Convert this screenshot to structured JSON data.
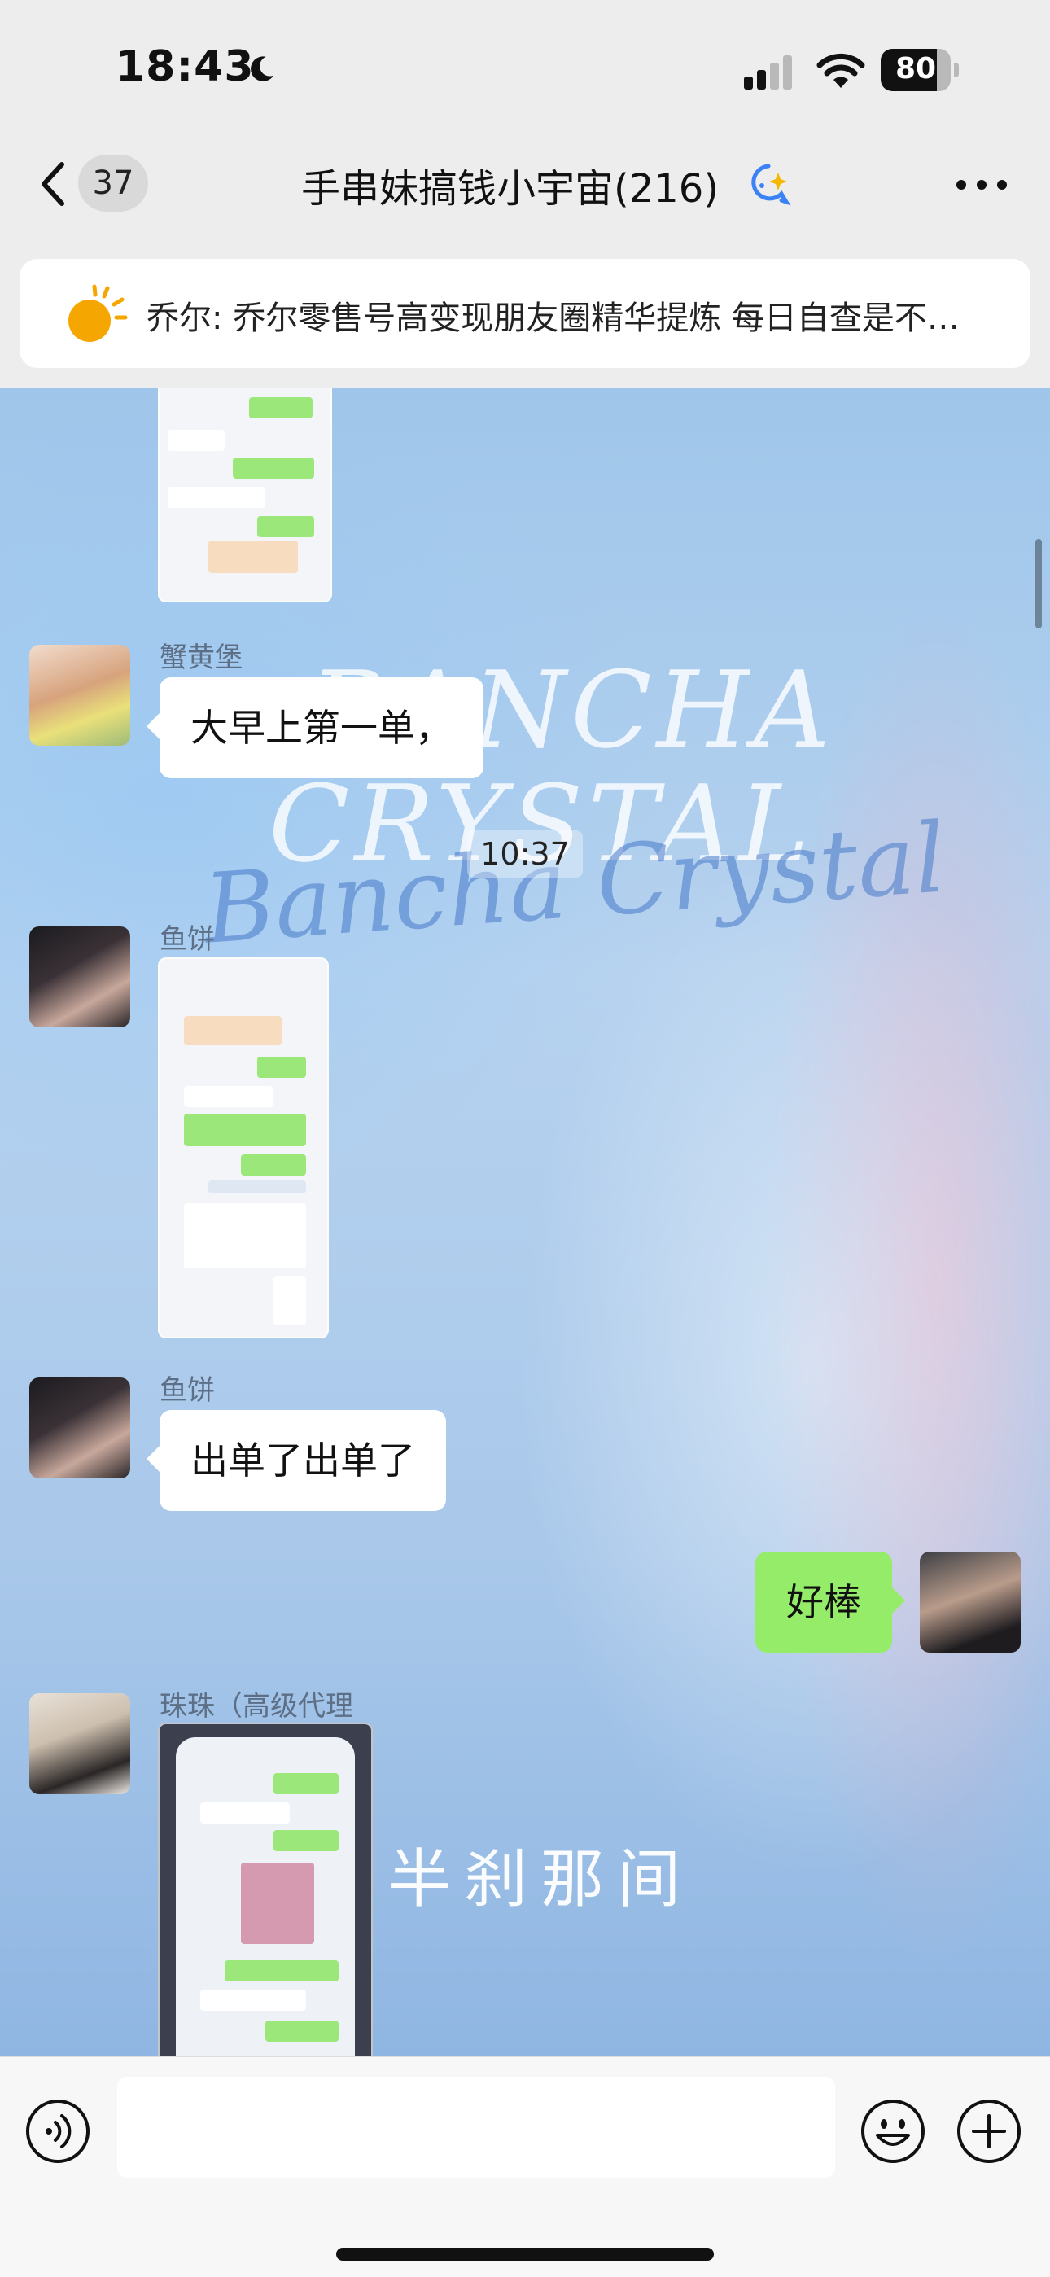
{
  "status_bar": {
    "time": "18:43",
    "battery_level": "80",
    "battery_fraction": 0.8,
    "icons": [
      "moon-icon",
      "cellular-signal-icon",
      "wifi-icon",
      "battery-icon"
    ]
  },
  "nav": {
    "back_icon": "chevron-left-icon",
    "unread_count": "37",
    "title": "手串妹搞钱小宇宙(216)",
    "ai_icon": "ai-chat-icon",
    "more_icon": "more-dots-icon"
  },
  "pinned": {
    "icon": "sun-icon",
    "text": "乔尔: 乔尔零售号高变现朋友圈精华提炼 每日自查是不…"
  },
  "background": {
    "line1": "BANCHA",
    "line2": "CRYSTAL",
    "script": "Bancha Crystal",
    "cn": "半刹那间"
  },
  "messages": [
    {
      "type": "image",
      "from": "other",
      "sender": "",
      "description": "chat screenshot"
    },
    {
      "type": "text",
      "from": "other",
      "sender": "蟹黄堡",
      "text": "大早上第一单，"
    },
    {
      "type": "time",
      "text": "10:37"
    },
    {
      "type": "image",
      "from": "other",
      "sender": "鱼饼",
      "description": "chat screenshot"
    },
    {
      "type": "text",
      "from": "other",
      "sender": "鱼饼",
      "text": "出单了出单了"
    },
    {
      "type": "text",
      "from": "self",
      "text": "好棒"
    },
    {
      "type": "image",
      "from": "other",
      "sender": "珠珠（高级代理",
      "description": "phone photo"
    }
  ],
  "input_bar": {
    "placeholder": "",
    "icons": [
      "voice-icon",
      "emoji-icon",
      "plus-icon"
    ]
  },
  "colors": {
    "self_bubble": "#95ec69",
    "other_bubble": "#ffffff",
    "header_bg": "#ededed"
  }
}
